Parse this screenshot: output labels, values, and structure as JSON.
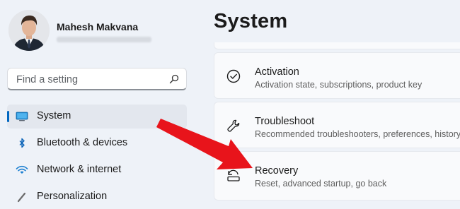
{
  "user": {
    "name": "Mahesh Makvana"
  },
  "search": {
    "placeholder": "Find a setting"
  },
  "sidebar": {
    "items": [
      {
        "label": "System",
        "icon": "monitor-icon",
        "selected": true
      },
      {
        "label": "Bluetooth & devices",
        "icon": "bluetooth-icon"
      },
      {
        "label": "Network & internet",
        "icon": "wifi-icon"
      },
      {
        "label": "Personalization",
        "icon": "brush-icon"
      }
    ]
  },
  "main": {
    "title": "System",
    "cards": [
      {
        "title": "Activation",
        "subtitle": "Activation state, subscriptions, product key",
        "icon": "check-circle-icon"
      },
      {
        "title": "Troubleshoot",
        "subtitle": "Recommended troubleshooters, preferences, history",
        "icon": "wrench-icon"
      },
      {
        "title": "Recovery",
        "subtitle": "Reset, advanced startup, go back",
        "icon": "recovery-icon"
      }
    ]
  },
  "colors": {
    "background": "#eef2f8",
    "accent": "#0067c0",
    "annotation_arrow": "#e8141b"
  }
}
